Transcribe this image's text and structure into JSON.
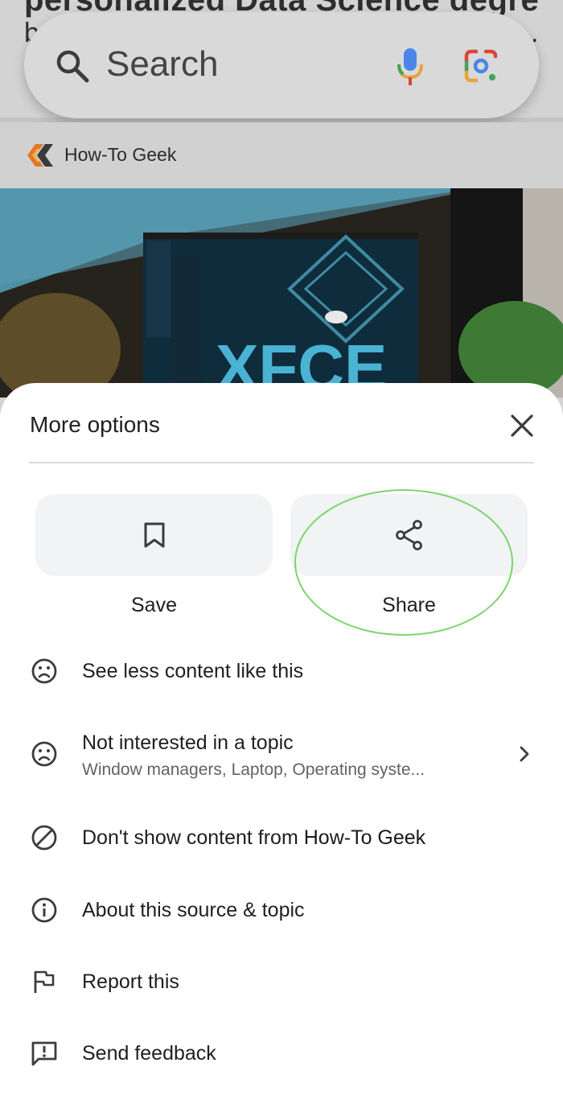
{
  "search": {
    "placeholder": "Search"
  },
  "background_page": {
    "prev_text_line1": "personalized Data Science degree",
    "prev_text_line2": "b",
    "prev_text_end": ".",
    "source_name": "How-To Geek"
  },
  "sheet": {
    "title": "More options",
    "actions": [
      {
        "label": "Save",
        "icon": "bookmark-icon"
      },
      {
        "label": "Share",
        "icon": "share-icon"
      }
    ],
    "options": [
      {
        "label": "See less content like this",
        "icon": "sad-face-icon"
      },
      {
        "label": "Not interested in a topic",
        "sublabel": "Window managers, Laptop, Operating syste...",
        "icon": "sad-face-icon"
      },
      {
        "label_prefix": "Don't show content from ",
        "label_source": "How-To Geek",
        "icon": "block-icon"
      },
      {
        "label": "About this source & topic",
        "icon": "info-icon"
      },
      {
        "label": "Report this",
        "icon": "flag-icon"
      },
      {
        "label": "Send feedback",
        "icon": "feedback-icon"
      }
    ]
  },
  "colors": {
    "sheet_bg": "#ffffff",
    "tile_bg": "#f1f3f4",
    "highlight": "#7ad66a",
    "text_primary": "#1f1f1f",
    "text_secondary": "#5f6368"
  }
}
